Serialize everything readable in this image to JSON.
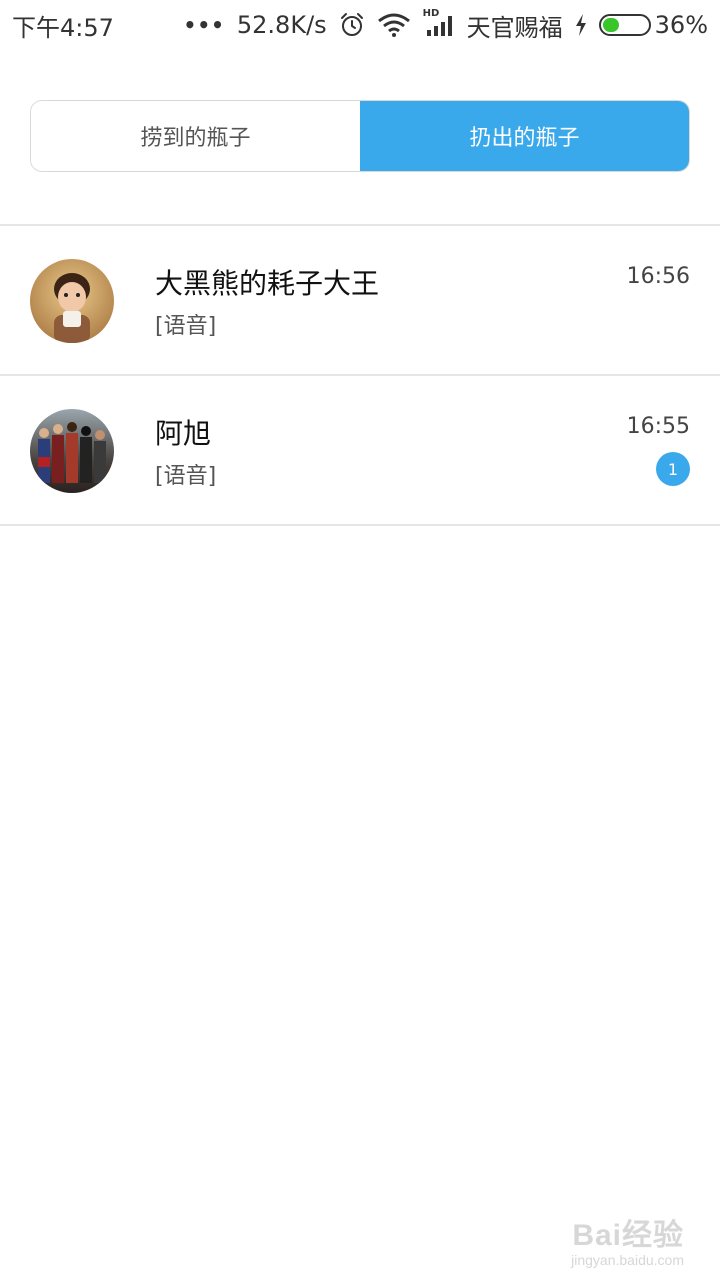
{
  "status_bar": {
    "time": "下午4:57",
    "dots": "•••",
    "net_speed": "52.8K/s",
    "alarm_icon": "alarm-clock-icon",
    "wifi_icon": "wifi-icon",
    "signal_icon": "hd-signal-icon",
    "hd": "HD",
    "carrier": "天官赐福",
    "charging_icon": "lightning-icon",
    "battery_percent": "36%",
    "battery_level": 0.36
  },
  "tabs": {
    "items": [
      {
        "label": "捞到的瓶子",
        "active": false
      },
      {
        "label": "扔出的瓶子",
        "active": true
      }
    ]
  },
  "conversations": [
    {
      "name": "大黑熊的耗子大王",
      "preview": "[语音]",
      "time": "16:56",
      "unread": ""
    },
    {
      "name": "阿旭",
      "preview": "[语音]",
      "time": "16:55",
      "unread": "1"
    }
  ],
  "watermark": {
    "brand": "Bai经验",
    "url": "jingyan.baidu.com"
  },
  "colors": {
    "accent": "#3aa9ec",
    "battery": "#39c62a",
    "divider": "#e6e6e6"
  }
}
